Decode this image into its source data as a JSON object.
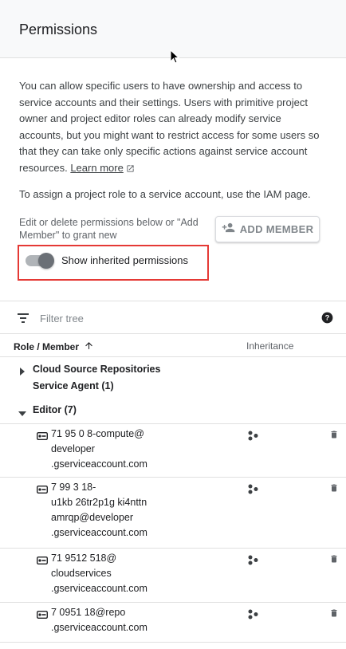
{
  "header": {
    "title": "Permissions"
  },
  "description": {
    "text": "You can allow specific users to have ownership and access to service accounts and their settings. Users with primitive project owner and project editor roles can already modify service accounts, but you might want to restrict access for some users so that they can take only specific actions against service account resources.",
    "learn_more": "Learn more"
  },
  "assign_note": "To assign a project role to a service account, use the IAM page.",
  "edit_note": "Edit or delete permissions below or \"Add Member\" to grant new",
  "add_member": {
    "label": "ADD MEMBER",
    "icon": "person-add-icon"
  },
  "toggle": {
    "label": "Show inherited permissions",
    "on": false
  },
  "filter": {
    "placeholder": "Filter tree",
    "value": ""
  },
  "table": {
    "col_role": "Role / Member",
    "col_inheritance": "Inheritance",
    "sort": "ascending"
  },
  "groups": [
    {
      "line1": "Cloud Source Repositories",
      "line2": "Service Agent (1)",
      "expanded": false
    },
    {
      "line1": "Editor (7)",
      "expanded": true
    }
  ],
  "members": [
    {
      "lines": [
        "71 95 0 8-compute@",
        "developer",
        ".gserviceaccount.com"
      ]
    },
    {
      "lines": [
        "7 99 3 18-",
        "u1kb 26tr2p1g ki4nttn",
        "amrqp@developer",
        ".gserviceaccount.com"
      ]
    },
    {
      "lines": [
        "71 9512 518@",
        "cloudservices",
        ".gserviceaccount.com"
      ]
    },
    {
      "lines": [
        "7 0951 18@repo",
        ".gserviceaccount.com"
      ]
    }
  ],
  "colors": {
    "highlight": "#e53935",
    "text": "#202124",
    "muted": "#5f6368"
  }
}
